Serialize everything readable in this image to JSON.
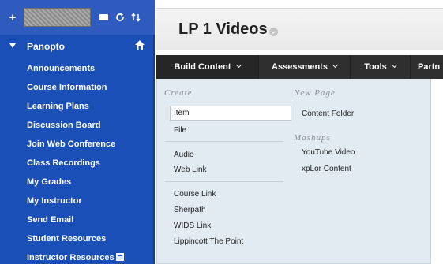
{
  "sidebar": {
    "header": "Panopto",
    "items": [
      {
        "label": "Announcements"
      },
      {
        "label": "Course Information"
      },
      {
        "label": "Learning Plans"
      },
      {
        "label": "Discussion Board"
      },
      {
        "label": "Join Web Conference"
      },
      {
        "label": "Class Recordings"
      },
      {
        "label": "My Grades"
      },
      {
        "label": "My Instructor"
      },
      {
        "label": "Send Email"
      },
      {
        "label": "Student Resources"
      },
      {
        "label": "Instructor Resources"
      }
    ]
  },
  "page": {
    "title": "LP 1 Videos"
  },
  "nav": {
    "tabs": [
      {
        "label": "Build Content"
      },
      {
        "label": "Assessments"
      },
      {
        "label": "Tools"
      },
      {
        "label": "Partn"
      }
    ]
  },
  "menu": {
    "create_label": "Create",
    "new_page_label": "New Page",
    "mashups_label": "Mashups",
    "create_items": [
      "Item",
      "File",
      "Audio",
      "Web Link",
      "Course Link",
      "Sherpath",
      "WIDS Link",
      "Lippincott The Point"
    ],
    "new_page_items": [
      "Content Folder"
    ],
    "mashup_items": [
      "YouTube Video",
      "xpLor Content"
    ]
  },
  "colors": {
    "sidebar_bg": "#1a4fb8",
    "navbar_bg": "#2f2f2f",
    "dropdown_bg": "#e2eaf2"
  }
}
